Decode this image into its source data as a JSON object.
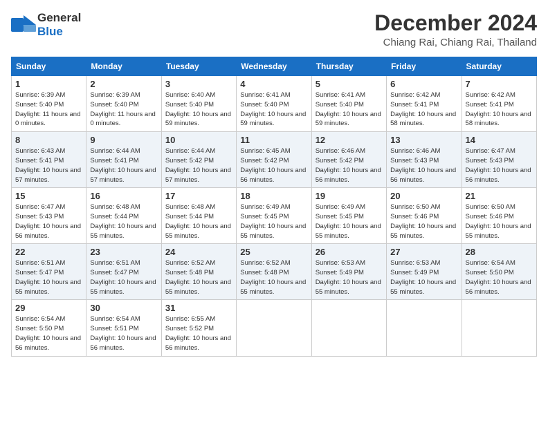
{
  "header": {
    "logo_general": "General",
    "logo_blue": "Blue",
    "month_title": "December 2024",
    "location": "Chiang Rai, Chiang Rai, Thailand"
  },
  "days_of_week": [
    "Sunday",
    "Monday",
    "Tuesday",
    "Wednesday",
    "Thursday",
    "Friday",
    "Saturday"
  ],
  "weeks": [
    [
      {
        "day": "1",
        "sunrise": "6:39 AM",
        "sunset": "5:40 PM",
        "daylight": "11 hours and 0 minutes."
      },
      {
        "day": "2",
        "sunrise": "6:39 AM",
        "sunset": "5:40 PM",
        "daylight": "11 hours and 0 minutes."
      },
      {
        "day": "3",
        "sunrise": "6:40 AM",
        "sunset": "5:40 PM",
        "daylight": "10 hours and 59 minutes."
      },
      {
        "day": "4",
        "sunrise": "6:41 AM",
        "sunset": "5:40 PM",
        "daylight": "10 hours and 59 minutes."
      },
      {
        "day": "5",
        "sunrise": "6:41 AM",
        "sunset": "5:40 PM",
        "daylight": "10 hours and 59 minutes."
      },
      {
        "day": "6",
        "sunrise": "6:42 AM",
        "sunset": "5:41 PM",
        "daylight": "10 hours and 58 minutes."
      },
      {
        "day": "7",
        "sunrise": "6:42 AM",
        "sunset": "5:41 PM",
        "daylight": "10 hours and 58 minutes."
      }
    ],
    [
      {
        "day": "8",
        "sunrise": "6:43 AM",
        "sunset": "5:41 PM",
        "daylight": "10 hours and 57 minutes."
      },
      {
        "day": "9",
        "sunrise": "6:44 AM",
        "sunset": "5:41 PM",
        "daylight": "10 hours and 57 minutes."
      },
      {
        "day": "10",
        "sunrise": "6:44 AM",
        "sunset": "5:42 PM",
        "daylight": "10 hours and 57 minutes."
      },
      {
        "day": "11",
        "sunrise": "6:45 AM",
        "sunset": "5:42 PM",
        "daylight": "10 hours and 56 minutes."
      },
      {
        "day": "12",
        "sunrise": "6:46 AM",
        "sunset": "5:42 PM",
        "daylight": "10 hours and 56 minutes."
      },
      {
        "day": "13",
        "sunrise": "6:46 AM",
        "sunset": "5:43 PM",
        "daylight": "10 hours and 56 minutes."
      },
      {
        "day": "14",
        "sunrise": "6:47 AM",
        "sunset": "5:43 PM",
        "daylight": "10 hours and 56 minutes."
      }
    ],
    [
      {
        "day": "15",
        "sunrise": "6:47 AM",
        "sunset": "5:43 PM",
        "daylight": "10 hours and 56 minutes."
      },
      {
        "day": "16",
        "sunrise": "6:48 AM",
        "sunset": "5:44 PM",
        "daylight": "10 hours and 55 minutes."
      },
      {
        "day": "17",
        "sunrise": "6:48 AM",
        "sunset": "5:44 PM",
        "daylight": "10 hours and 55 minutes."
      },
      {
        "day": "18",
        "sunrise": "6:49 AM",
        "sunset": "5:45 PM",
        "daylight": "10 hours and 55 minutes."
      },
      {
        "day": "19",
        "sunrise": "6:49 AM",
        "sunset": "5:45 PM",
        "daylight": "10 hours and 55 minutes."
      },
      {
        "day": "20",
        "sunrise": "6:50 AM",
        "sunset": "5:46 PM",
        "daylight": "10 hours and 55 minutes."
      },
      {
        "day": "21",
        "sunrise": "6:50 AM",
        "sunset": "5:46 PM",
        "daylight": "10 hours and 55 minutes."
      }
    ],
    [
      {
        "day": "22",
        "sunrise": "6:51 AM",
        "sunset": "5:47 PM",
        "daylight": "10 hours and 55 minutes."
      },
      {
        "day": "23",
        "sunrise": "6:51 AM",
        "sunset": "5:47 PM",
        "daylight": "10 hours and 55 minutes."
      },
      {
        "day": "24",
        "sunrise": "6:52 AM",
        "sunset": "5:48 PM",
        "daylight": "10 hours and 55 minutes."
      },
      {
        "day": "25",
        "sunrise": "6:52 AM",
        "sunset": "5:48 PM",
        "daylight": "10 hours and 55 minutes."
      },
      {
        "day": "26",
        "sunrise": "6:53 AM",
        "sunset": "5:49 PM",
        "daylight": "10 hours and 55 minutes."
      },
      {
        "day": "27",
        "sunrise": "6:53 AM",
        "sunset": "5:49 PM",
        "daylight": "10 hours and 55 minutes."
      },
      {
        "day": "28",
        "sunrise": "6:54 AM",
        "sunset": "5:50 PM",
        "daylight": "10 hours and 56 minutes."
      }
    ],
    [
      {
        "day": "29",
        "sunrise": "6:54 AM",
        "sunset": "5:50 PM",
        "daylight": "10 hours and 56 minutes."
      },
      {
        "day": "30",
        "sunrise": "6:54 AM",
        "sunset": "5:51 PM",
        "daylight": "10 hours and 56 minutes."
      },
      {
        "day": "31",
        "sunrise": "6:55 AM",
        "sunset": "5:52 PM",
        "daylight": "10 hours and 56 minutes."
      },
      null,
      null,
      null,
      null
    ]
  ]
}
